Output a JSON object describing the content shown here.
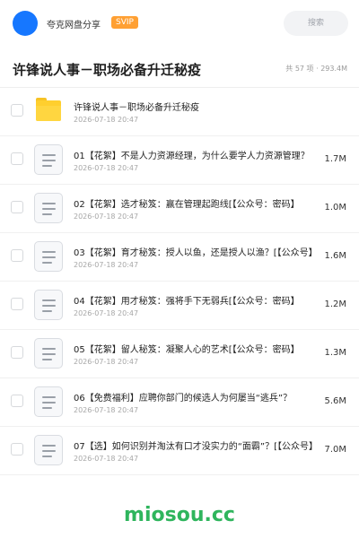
{
  "header": {
    "share_title": "夸克网盘分享",
    "badge": "SVIP",
    "search_placeholder": "搜索"
  },
  "folder": {
    "title": "许锋说人事－职场必备升迁秘疫",
    "summary": "共 57 项 · 293.4M"
  },
  "items": [
    {
      "type": "folder",
      "name": "许锋说人事－职场必备升迁秘疫",
      "date": "2026-07-18 20:47",
      "size": ""
    },
    {
      "type": "file",
      "name": "01【花絮】不是人力资源经理，为什么要学人力资源管理？",
      "date": "2026-07-18 20:47",
      "size": "1.7M"
    },
    {
      "type": "file",
      "name": "02【花絮】选才秘笈：赢在管理起跑线[【公众号：密码】",
      "date": "2026-07-18 20:47",
      "size": "1.0M"
    },
    {
      "type": "file",
      "name": "03【花絮】育才秘笈：授人以鱼，还是授人以渔？[【公众号】",
      "date": "2026-07-18 20:47",
      "size": "1.6M"
    },
    {
      "type": "file",
      "name": "04【花絮】用才秘笈：强将手下无弱兵[【公众号：密码】",
      "date": "2026-07-18 20:47",
      "size": "1.2M"
    },
    {
      "type": "file",
      "name": "05【花絮】留人秘笈：凝聚人心的艺术[【公众号：密码】",
      "date": "2026-07-18 20:47",
      "size": "1.3M"
    },
    {
      "type": "file",
      "name": "06【免费福利】应聘你部门的候选人为何屡当“逃兵”？",
      "date": "2026-07-18 20:47",
      "size": "5.6M"
    },
    {
      "type": "file",
      "name": "07【选】如何识别并淘汰有口才没实力的“面霸”？[【公众号】",
      "date": "2026-07-18 20:47",
      "size": "7.0M"
    }
  ],
  "watermark": "miosou.cc",
  "colors": {
    "accent": "#1677ff",
    "svip_badge": "#ffa033",
    "folder": "#ffcf2e",
    "watermark": "#2fb55d"
  }
}
